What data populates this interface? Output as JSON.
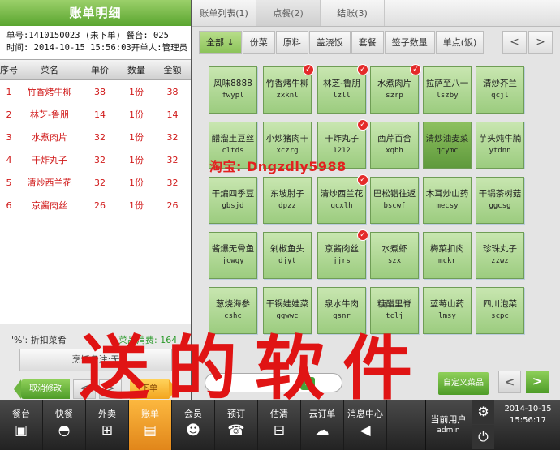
{
  "left": {
    "title": "账单明细",
    "order_line": "单号:1410150023 (未下单) 餐台: 025",
    "time_line": "时间: 2014-10-15 15:56:03开单人:管理员",
    "columns": [
      "序号",
      "菜名",
      "单价",
      "数量",
      "金额"
    ],
    "rows": [
      {
        "idx": "1",
        "name": "竹香烤牛柳",
        "price": "38",
        "qty": "1份",
        "amount": "38"
      },
      {
        "idx": "2",
        "name": "林芝-鲁朋",
        "price": "14",
        "qty": "1份",
        "amount": "14"
      },
      {
        "idx": "3",
        "name": "水煮肉片",
        "price": "32",
        "qty": "1份",
        "amount": "32"
      },
      {
        "idx": "4",
        "name": "干炸丸子",
        "price": "32",
        "qty": "1份",
        "amount": "32"
      },
      {
        "idx": "5",
        "name": "清炒西兰花",
        "price": "32",
        "qty": "1份",
        "amount": "32"
      },
      {
        "idx": "6",
        "name": "京酱肉丝",
        "price": "26",
        "qty": "1份",
        "amount": "26"
      }
    ],
    "discount_label": "'%': 折扣菜肴",
    "consume_label": "菜品消费: 164",
    "remark_label": "烹饪备注:无",
    "cancel_label": "取消修改",
    "prev_icon": "<",
    "next_icon": ">",
    "order_label": "下单"
  },
  "tabs": [
    "账单列表(1)",
    "点餐(2)",
    "结账(3)"
  ],
  "categories": [
    "全部 ↓",
    "份菜",
    "原料",
    "盖浇饭",
    "套餐",
    "签子数量",
    "单点(饭)"
  ],
  "cat_prev_icon": "<",
  "cat_next_icon": ">",
  "dishes": [
    {
      "name": "风味8888",
      "code": "fwypl",
      "checked": false,
      "selected": false
    },
    {
      "name": "竹香烤牛柳",
      "code": "zxknl",
      "checked": true,
      "selected": false
    },
    {
      "name": "林芝-鲁朋",
      "code": "lzll",
      "checked": true,
      "selected": false
    },
    {
      "name": "水煮肉片",
      "code": "szrp",
      "checked": true,
      "selected": false
    },
    {
      "name": "拉萨至八一",
      "code": "lszby",
      "checked": false,
      "selected": false
    },
    {
      "name": "清炒芥兰",
      "code": "qcjl",
      "checked": false,
      "selected": false
    },
    {
      "name": "醋溜土豆丝",
      "code": "cltds",
      "checked": false,
      "selected": false
    },
    {
      "name": "小炒猪肉干",
      "code": "xczrg",
      "checked": false,
      "selected": false
    },
    {
      "name": "干炸丸子",
      "code": "1212",
      "checked": true,
      "selected": false
    },
    {
      "name": "西芹百合",
      "code": "xqbh",
      "checked": false,
      "selected": false
    },
    {
      "name": "清炒油麦菜",
      "code": "qcymc",
      "checked": false,
      "selected": true
    },
    {
      "name": "芋头炖牛腩",
      "code": "ytdnn",
      "checked": false,
      "selected": false
    },
    {
      "name": "干煸四季豆",
      "code": "gbsjd",
      "checked": false,
      "selected": false
    },
    {
      "name": "东坡肘子",
      "code": "dpzz",
      "checked": false,
      "selected": false
    },
    {
      "name": "清炒西兰花",
      "code": "qcxlh",
      "checked": true,
      "selected": false
    },
    {
      "name": "巴松错往返",
      "code": "bscwf",
      "checked": false,
      "selected": false
    },
    {
      "name": "木耳炒山药",
      "code": "mecsy",
      "checked": false,
      "selected": false
    },
    {
      "name": "干锅茶树菇",
      "code": "ggcsg",
      "checked": false,
      "selected": false
    },
    {
      "name": "酱爆无骨鱼",
      "code": "jcwgy",
      "checked": false,
      "selected": false
    },
    {
      "name": "剁椒鱼头",
      "code": "djyt",
      "checked": false,
      "selected": false
    },
    {
      "name": "京酱肉丝",
      "code": "jjrs",
      "checked": true,
      "selected": false
    },
    {
      "name": "水煮虾",
      "code": "szx",
      "checked": false,
      "selected": false
    },
    {
      "name": "梅菜扣肉",
      "code": "mckr",
      "checked": false,
      "selected": false
    },
    {
      "name": "珍珠丸子",
      "code": "zzwz",
      "checked": false,
      "selected": false
    },
    {
      "name": "葱烧海参",
      "code": "cshc",
      "checked": false,
      "selected": false
    },
    {
      "name": "干锅娃娃菜",
      "code": "ggwwc",
      "checked": false,
      "selected": false
    },
    {
      "name": "泉水牛肉",
      "code": "qsnr",
      "checked": false,
      "selected": false
    },
    {
      "name": "糖醋里脊",
      "code": "tclj",
      "checked": false,
      "selected": false
    },
    {
      "name": "蓝莓山药",
      "code": "lmsy",
      "checked": false,
      "selected": false
    },
    {
      "name": "四川泡菜",
      "code": "scpc",
      "checked": false,
      "selected": false
    }
  ],
  "watermark_taobao": "淘宝: Dngzdly5988",
  "watermark_big": "送的软件",
  "search": {
    "placeholder": ""
  },
  "custom_dish_label": "自定义菜品",
  "right_prev_icon": "<",
  "right_next_icon": ">",
  "bottom_nav": [
    {
      "label": "餐台",
      "icon": "table-icon",
      "glyph": "▣",
      "active": false
    },
    {
      "label": "快餐",
      "icon": "burger-icon",
      "glyph": "◓",
      "active": false
    },
    {
      "label": "外卖",
      "icon": "cart-icon",
      "glyph": "⊞",
      "active": false
    },
    {
      "label": "账单",
      "icon": "clipboard-icon",
      "glyph": "▤",
      "active": true
    },
    {
      "label": "会员",
      "icon": "members-icon",
      "glyph": "☻",
      "active": false
    },
    {
      "label": "预订",
      "icon": "phone-icon",
      "glyph": "☎",
      "active": false
    },
    {
      "label": "估清",
      "icon": "basket-icon",
      "glyph": "⊟",
      "active": false
    },
    {
      "label": "云订单",
      "icon": "cloud-icon",
      "glyph": "☁",
      "active": false
    },
    {
      "label": "消息中心",
      "icon": "speaker-icon",
      "glyph": "◀",
      "active": false
    }
  ],
  "user": {
    "label": "当前用户",
    "name": "admin"
  },
  "settings_icon": "⚙",
  "power_icon": "⏻",
  "clock": {
    "date": "2014-10-15",
    "time": "15:56:17"
  }
}
